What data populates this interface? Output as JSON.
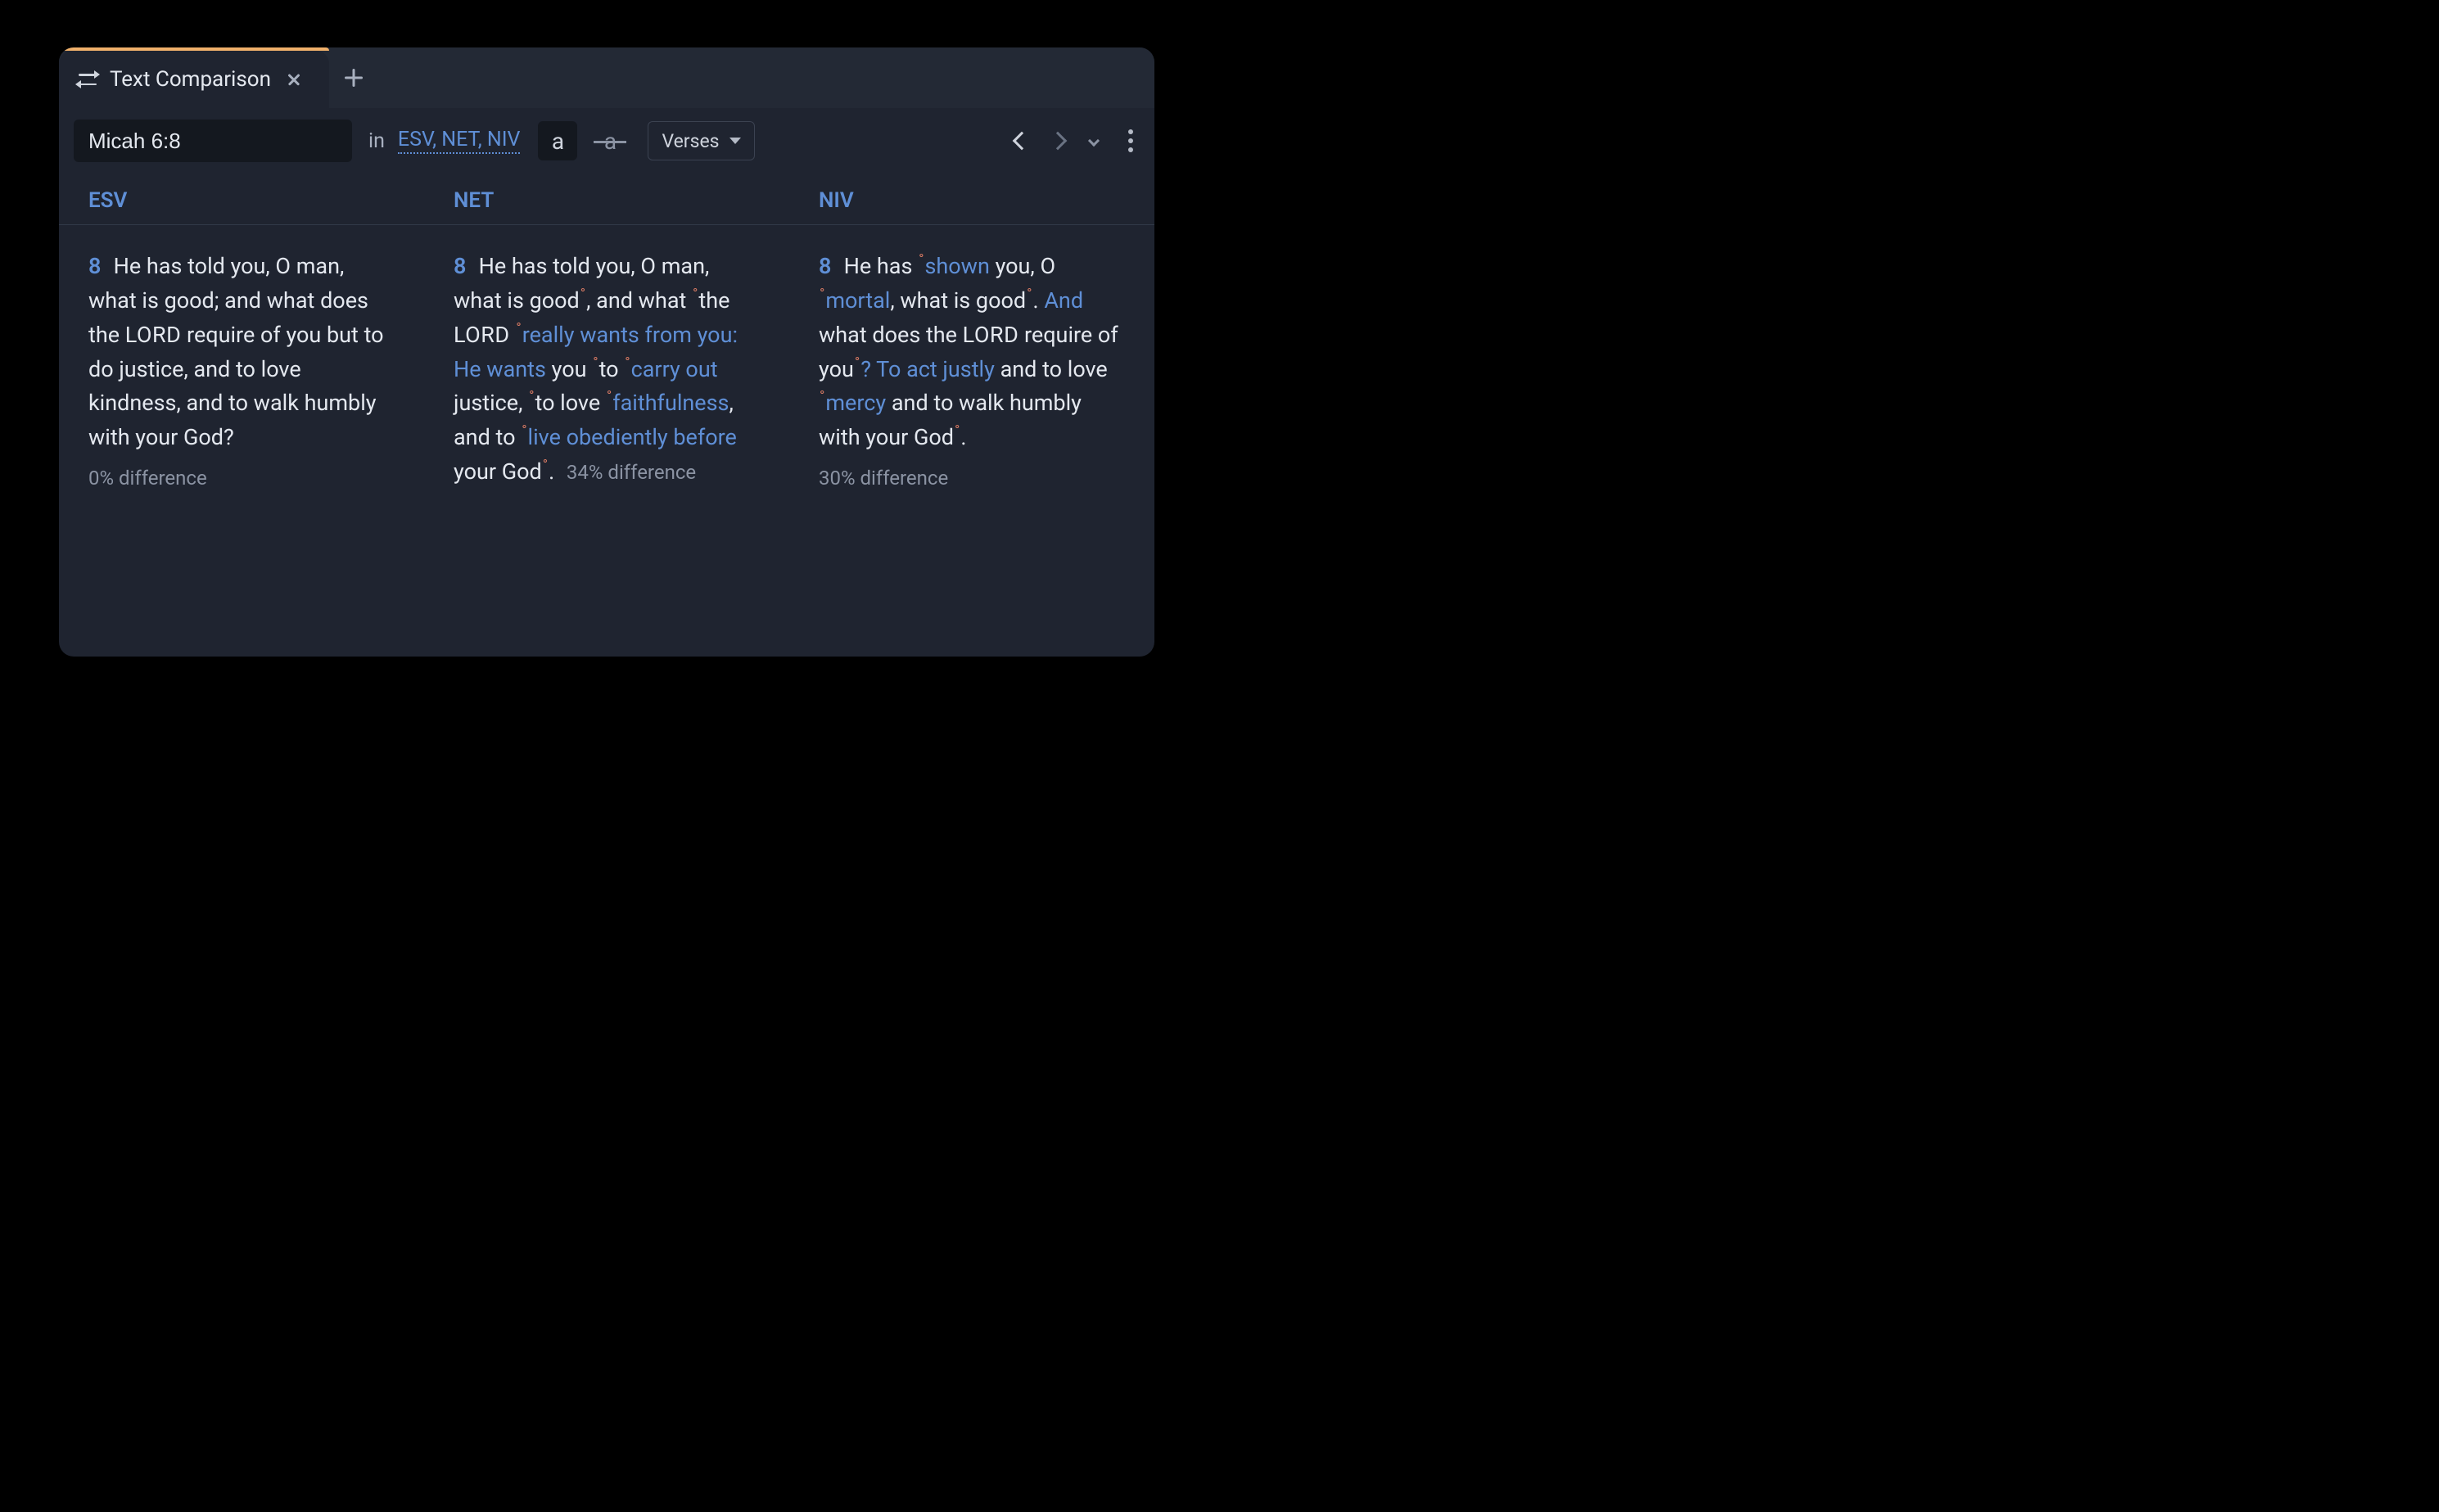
{
  "tab": {
    "title": "Text Comparison"
  },
  "toolbar": {
    "reference": "Micah 6:8",
    "in_label": "in",
    "versions_link": "ESV, NET, NIV",
    "toggle_a": "a",
    "toggle_strike": "a",
    "mode_label": "Verses"
  },
  "columns": [
    {
      "header": "ESV"
    },
    {
      "header": "NET"
    },
    {
      "header": "NIV"
    }
  ],
  "verse_number": "8",
  "esv": {
    "segments": [
      {
        "t": "He has told you, O man, what is good; and what does the ",
        "k": "plain"
      },
      {
        "t": "LORD",
        "k": "sc"
      },
      {
        "t": " require of you but to do justice, and to love kindness, and to walk humbly with your God?",
        "k": "plain"
      }
    ],
    "pct": "0% difference"
  },
  "net": {
    "segments": [
      {
        "t": "He has told you, O man, what is good",
        "k": "plain"
      },
      {
        "k": "dot"
      },
      {
        "t": ", and what ",
        "k": "plain"
      },
      {
        "k": "dot"
      },
      {
        "t": "the ",
        "k": "plain"
      },
      {
        "t": "LORD",
        "k": "sc"
      },
      {
        "t": " ",
        "k": "plain"
      },
      {
        "k": "dot"
      },
      {
        "t": "really wants from you: He wants",
        "k": "diff"
      },
      {
        "t": " you ",
        "k": "plain"
      },
      {
        "k": "dot"
      },
      {
        "t": "to ",
        "k": "plain"
      },
      {
        "k": "dot"
      },
      {
        "t": "carry out",
        "k": "diff"
      },
      {
        "t": " justice, ",
        "k": "plain"
      },
      {
        "k": "dot"
      },
      {
        "t": "to love ",
        "k": "plain"
      },
      {
        "k": "dot"
      },
      {
        "t": "faithfulness",
        "k": "diff"
      },
      {
        "t": ", and to ",
        "k": "plain"
      },
      {
        "k": "dot"
      },
      {
        "t": "live obediently before",
        "k": "diff"
      },
      {
        "t": " your God",
        "k": "plain"
      },
      {
        "k": "dot"
      },
      {
        "t": ".",
        "k": "plain"
      }
    ],
    "pct": "34% difference"
  },
  "niv": {
    "segments": [
      {
        "t": "He has ",
        "k": "plain"
      },
      {
        "k": "dot"
      },
      {
        "t": "shown",
        "k": "diff"
      },
      {
        "t": " you, O ",
        "k": "plain"
      },
      {
        "k": "dot"
      },
      {
        "t": "mortal",
        "k": "diff"
      },
      {
        "t": ", what is good",
        "k": "plain"
      },
      {
        "k": "dot"
      },
      {
        "t": ". ",
        "k": "plain"
      },
      {
        "t": "And",
        "k": "diff"
      },
      {
        "t": " what does the ",
        "k": "plain"
      },
      {
        "t": "LORD",
        "k": "sc"
      },
      {
        "t": " require of you",
        "k": "plain"
      },
      {
        "k": "dot"
      },
      {
        "t": "? To act justly",
        "k": "diff"
      },
      {
        "t": " and to love ",
        "k": "plain"
      },
      {
        "k": "dot"
      },
      {
        "t": "mercy",
        "k": "diff"
      },
      {
        "t": " and to walk humbly with your God",
        "k": "plain"
      },
      {
        "k": "dot"
      },
      {
        "t": ".",
        "k": "plain"
      }
    ],
    "pct": "30% difference"
  }
}
